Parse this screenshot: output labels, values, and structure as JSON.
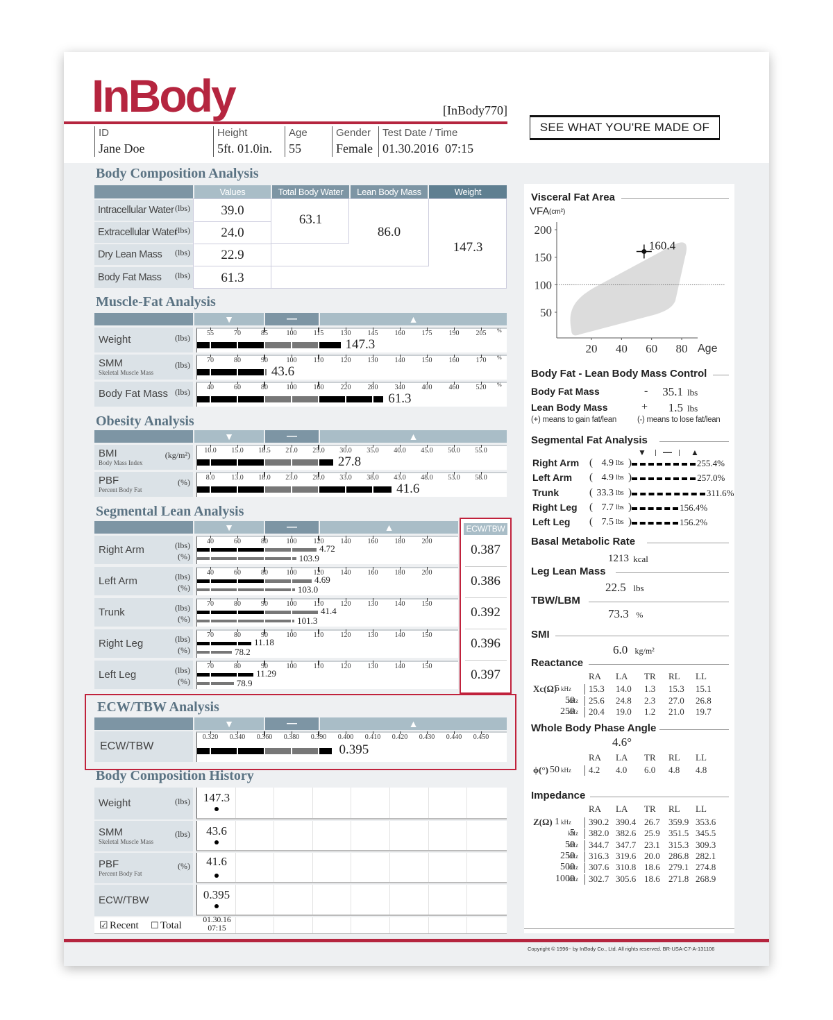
{
  "colors": {
    "brand_red": "#b5253f",
    "section_title": "#5b7383",
    "header_dark": "#7d95a4",
    "header_light": "#a9bdc7",
    "label_cell": "#dbe2e7",
    "highlight_box": "#c0223c"
  },
  "header": {
    "logo": "InBody",
    "model": "[InBody770]",
    "slogan": "SEE WHAT YOU'RE MADE OF",
    "fields": [
      {
        "label": "ID",
        "value": "Jane Doe"
      },
      {
        "label": "Height",
        "value": "5ft. 01.0in."
      },
      {
        "label": "Age",
        "value": "55"
      },
      {
        "label": "Gender",
        "value": "Female"
      },
      {
        "label": "Test Date / Time",
        "value": "01.30.2016  07:15"
      }
    ]
  },
  "bca": {
    "title": "Body Composition Analysis",
    "columns": [
      "Values",
      "Total Body Water",
      "Lean Body Mass",
      "Weight"
    ],
    "rows": [
      {
        "label": "Intracellular Water",
        "unit": "(lbs)",
        "value": "39.0"
      },
      {
        "label": "Extracellular Water",
        "unit": "(lbs)",
        "value": "24.0"
      },
      {
        "label": "Dry Lean Mass",
        "unit": "(lbs)",
        "value": "22.9"
      },
      {
        "label": "Body Fat Mass",
        "unit": "(lbs)",
        "value": "61.3"
      }
    ],
    "total_body_water": "63.1",
    "lean_body_mass": "86.0",
    "weight": "147.3"
  },
  "range_icons": {
    "under": "▼",
    "normal": "—",
    "over": "▲"
  },
  "mfa": {
    "title": "Muscle-Fat Analysis",
    "percent_mark": "%",
    "rows": [
      {
        "label": "Weight",
        "sublabel": "",
        "unit": "(lbs)",
        "ticks": [
          "55",
          "70",
          "85",
          "100",
          "115",
          "130",
          "145",
          "160",
          "175",
          "190",
          "205"
        ],
        "level_percent": 127.5,
        "value": "147.3"
      },
      {
        "label": "SMM",
        "sublabel": "Skeletal Muscle Mass",
        "unit": "(lbs)",
        "ticks": [
          "70",
          "80",
          "90",
          "100",
          "110",
          "120",
          "130",
          "140",
          "150",
          "160",
          "170"
        ],
        "level_percent": 91,
        "value": "43.6"
      },
      {
        "label": "Body Fat Mass",
        "sublabel": "",
        "unit": "(lbs)",
        "ticks": [
          "40",
          "60",
          "80",
          "100",
          "160",
          "220",
          "280",
          "340",
          "400",
          "460",
          "520"
        ],
        "level_percent": 305,
        "value": "61.3"
      }
    ]
  },
  "obesity": {
    "title": "Obesity Analysis",
    "rows": [
      {
        "label": "BMI",
        "sublabel": "Body Mass Index",
        "unit": "(kg/m²)",
        "ticks": [
          "10.0",
          "15.0",
          "18.5",
          "21.0",
          "25.0",
          "30.0",
          "35.0",
          "40.0",
          "45.0",
          "50.0",
          "55.0"
        ],
        "level": 27.8,
        "value": "27.8"
      },
      {
        "label": "PBF",
        "sublabel": "Percent Body Fat",
        "unit": "(%)",
        "ticks": [
          "8.0",
          "13.0",
          "18.0",
          "23.0",
          "28.0",
          "33.0",
          "38.0",
          "43.0",
          "48.0",
          "53.0",
          "58.0"
        ],
        "level": 41.6,
        "value": "41.6"
      }
    ]
  },
  "sla": {
    "title": "Segmental Lean Analysis",
    "ecw_header": "ECW/TBW",
    "rows": [
      {
        "label": "Right Arm",
        "unit_lbs": "(lbs)",
        "unit_pct": "(%)",
        "ticks": [
          "40",
          "60",
          "80",
          "100",
          "120",
          "140",
          "160",
          "180",
          "200"
        ],
        "lbs_level_percent": 119,
        "lbs": "4.72",
        "pct": "103.9",
        "ecw_tbw": "0.387"
      },
      {
        "label": "Left Arm",
        "unit_lbs": "(lbs)",
        "unit_pct": "(%)",
        "ticks": [
          "40",
          "60",
          "80",
          "100",
          "120",
          "140",
          "160",
          "180",
          "200"
        ],
        "lbs_level_percent": 115.4,
        "lbs": "4.69",
        "pct": "103.0",
        "ecw_tbw": "0.386"
      },
      {
        "label": "Trunk",
        "unit_lbs": "(lbs)",
        "unit_pct": "(%)",
        "ticks": [
          "70",
          "80",
          "90",
          "100",
          "110",
          "120",
          "130",
          "140",
          "150"
        ],
        "lbs_level_percent": 110,
        "lbs": "41.4",
        "pct": "101.3",
        "ecw_tbw": "0.392"
      },
      {
        "label": "Right Leg",
        "unit_lbs": "(lbs)",
        "unit_pct": "(%)",
        "ticks": [
          "70",
          "80",
          "90",
          "100",
          "110",
          "120",
          "130",
          "140",
          "150"
        ],
        "lbs_level_percent": 85.4,
        "lbs": "11.18",
        "pct": "78.2",
        "ecw_tbw": "0.396"
      },
      {
        "label": "Left Leg",
        "unit_lbs": "(lbs)",
        "unit_pct": "(%)",
        "ticks": [
          "70",
          "80",
          "90",
          "100",
          "110",
          "120",
          "130",
          "140",
          "150"
        ],
        "lbs_level_percent": 86.2,
        "lbs": "11.29",
        "pct": "78.9",
        "ecw_tbw": "0.397"
      }
    ]
  },
  "ecw": {
    "title": "ECW/TBW Analysis",
    "row": {
      "label": "ECW/TBW",
      "ticks": [
        "0.320",
        "0.340",
        "0.360",
        "0.380",
        "0.390",
        "0.400",
        "0.410",
        "0.420",
        "0.430",
        "0.440",
        "0.450"
      ],
      "level": 0.395,
      "value": "0.395"
    }
  },
  "history": {
    "title": "Body Composition History",
    "rows": [
      {
        "label": "Weight",
        "sublabel": "",
        "unit": "(lbs)",
        "value": "147.3"
      },
      {
        "label": "SMM",
        "sublabel": "Skeletal Muscle Mass",
        "unit": "(lbs)",
        "value": "43.6"
      },
      {
        "label": "PBF",
        "sublabel": "Percent Body Fat",
        "unit": "(%)",
        "value": "41.6"
      },
      {
        "label": "ECW/TBW",
        "sublabel": "",
        "unit": "",
        "value": "0.395"
      }
    ],
    "recent_label": "Recent",
    "recent_checked": true,
    "total_label": "Total",
    "total_checked": false,
    "date": "01.30.16",
    "time": "07:15"
  },
  "vfa": {
    "title": "Visceral Fat Area",
    "ylabel": "VFA",
    "yunit": "(cm²)",
    "xlabel": "Age",
    "yticks": [
      "200",
      "150",
      "100",
      "50"
    ],
    "xticks": [
      "20",
      "40",
      "60",
      "80"
    ],
    "point": {
      "age": 55,
      "vfa": 160.4,
      "label": "160.4"
    }
  },
  "control": {
    "title": "Body Fat - Lean Body Mass Control",
    "rows": [
      {
        "label": "Body Fat Mass",
        "sign": "-",
        "value": "35.1",
        "unit": "lbs"
      },
      {
        "label": "Lean Body Mass",
        "sign": "+",
        "value": "1.5",
        "unit": "lbs"
      }
    ],
    "note_plus": "(+) means to gain fat/lean",
    "note_minus": "(-) means to lose fat/lean"
  },
  "sfa": {
    "title": "Segmental Fat Analysis",
    "rows": [
      {
        "label": "Right Arm",
        "value": "4.9",
        "unit": "lbs",
        "percent": "255.4%",
        "level": 255.4
      },
      {
        "label": "Left Arm",
        "value": "4.9",
        "unit": "lbs",
        "percent": "257.0%",
        "level": 257.0
      },
      {
        "label": "Trunk",
        "value": "33.3",
        "unit": "lbs",
        "percent": "311.6%",
        "level": 311.6
      },
      {
        "label": "Right Leg",
        "value": "7.7",
        "unit": "lbs",
        "percent": "156.4%",
        "level": 156.4
      },
      {
        "label": "Left Leg",
        "value": "7.5",
        "unit": "lbs",
        "percent": "156.2%",
        "level": 156.2
      }
    ]
  },
  "bmr": {
    "title": "Basal Metabolic Rate",
    "value": "1213",
    "unit": "kcal"
  },
  "leg_lean": {
    "title": "Leg Lean Mass",
    "value": "22.5",
    "unit": "lbs"
  },
  "tbw_lbm": {
    "title": "TBW/LBM",
    "value": "73.3",
    "unit": "%"
  },
  "smi": {
    "title": "SMI",
    "value": "6.0",
    "unit": "kg/m²"
  },
  "reactance": {
    "title": "Reactance",
    "symbol": "Xc(Ω)",
    "columns": [
      "RA",
      "LA",
      "TR",
      "RL",
      "LL"
    ],
    "rows": [
      {
        "freq": "5",
        "unit": "kHz",
        "values": [
          "15.3",
          "14.0",
          "1.3",
          "15.3",
          "15.1"
        ]
      },
      {
        "freq": "50",
        "unit": "kHz",
        "values": [
          "25.6",
          "24.8",
          "2.3",
          "27.0",
          "26.8"
        ]
      },
      {
        "freq": "250",
        "unit": "kHz",
        "values": [
          "20.4",
          "19.0",
          "1.2",
          "21.0",
          "19.7"
        ]
      }
    ]
  },
  "phase": {
    "title": "Whole Body Phase Angle",
    "value": "4.6°",
    "symbol": "ϕ(°)",
    "columns": [
      "RA",
      "LA",
      "TR",
      "RL",
      "LL"
    ],
    "row": {
      "freq": "50",
      "unit": "kHz",
      "values": [
        "4.2",
        "4.0",
        "6.0",
        "4.8",
        "4.8"
      ]
    }
  },
  "impedance": {
    "title": "Impedance",
    "symbol": "Z(Ω)",
    "columns": [
      "RA",
      "LA",
      "TR",
      "RL",
      "LL"
    ],
    "rows": [
      {
        "freq": "1",
        "unit": "kHz",
        "values": [
          "390.2",
          "390.4",
          "26.7",
          "359.9",
          "353.6"
        ]
      },
      {
        "freq": "5",
        "unit": "kHz",
        "values": [
          "382.0",
          "382.6",
          "25.9",
          "351.5",
          "345.5"
        ]
      },
      {
        "freq": "50",
        "unit": "kHz",
        "values": [
          "344.7",
          "347.7",
          "23.1",
          "315.3",
          "309.3"
        ]
      },
      {
        "freq": "250",
        "unit": "kHz",
        "values": [
          "316.3",
          "319.6",
          "20.0",
          "286.8",
          "282.1"
        ]
      },
      {
        "freq": "500",
        "unit": "kHz",
        "values": [
          "307.6",
          "310.8",
          "18.6",
          "279.1",
          "274.8"
        ]
      },
      {
        "freq": "1000",
        "unit": "kHz",
        "values": [
          "302.7",
          "305.6",
          "18.6",
          "271.8",
          "268.9"
        ]
      }
    ]
  },
  "copyright": "Copyright © 1996~ by InBody Co., Ltd. All rights reserved. BR-USA-C7-A-131106"
}
